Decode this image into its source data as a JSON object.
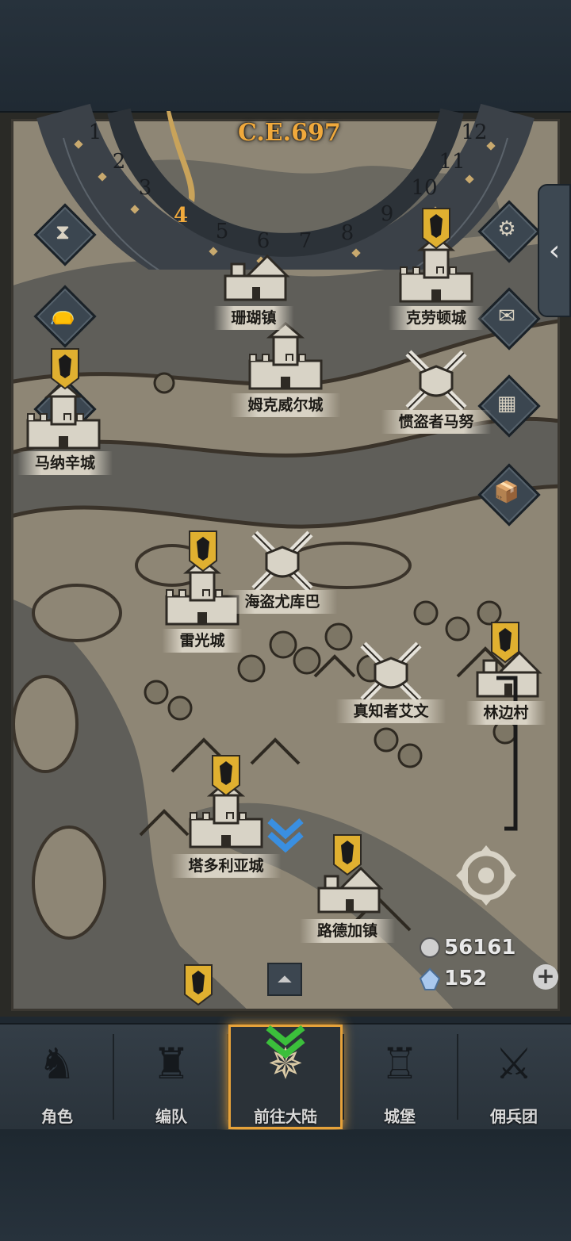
{
  "calendar": {
    "year": "C.E.697",
    "months": [
      "1",
      "2",
      "3",
      "4",
      "5",
      "6",
      "7",
      "8",
      "9",
      "10",
      "11",
      "12"
    ],
    "current_month": "4"
  },
  "locations": [
    {
      "key": "shanhu",
      "label": "珊瑚镇",
      "type": "town"
    },
    {
      "key": "kelaodun",
      "label": "克劳顿城",
      "type": "castle"
    },
    {
      "key": "mukeweier",
      "label": "姆克威尔城",
      "type": "castle"
    },
    {
      "key": "manu",
      "label": "惯盗者马努",
      "type": "battle"
    },
    {
      "key": "manaxin",
      "label": "马纳辛城",
      "type": "castle"
    },
    {
      "key": "youkuba",
      "label": "海盗尤库巴",
      "type": "battle"
    },
    {
      "key": "leiguang",
      "label": "雷光城",
      "type": "castle"
    },
    {
      "key": "aiwen",
      "label": "真知者艾文",
      "type": "battle"
    },
    {
      "key": "linbian",
      "label": "林边村",
      "type": "village"
    },
    {
      "key": "taduoliya",
      "label": "塔多利亚城",
      "type": "castle"
    },
    {
      "key": "ludejia",
      "label": "路德加镇",
      "type": "town"
    }
  ],
  "side_buttons": [
    "hourglass-icon",
    "bag-icon",
    "scroll-icon",
    "gear-icon",
    "mail-icon",
    "board-icon",
    "supplies-icon"
  ],
  "currency": {
    "silver": "56161",
    "crystal": "152"
  },
  "nav": [
    {
      "label": "角色",
      "icon": "knight-icon"
    },
    {
      "label": "编队",
      "icon": "team-icon"
    },
    {
      "label": "前往大陆",
      "icon": "continent-icon",
      "active": true
    },
    {
      "label": "城堡",
      "icon": "castle-icon"
    },
    {
      "label": "佣兵团",
      "icon": "mercenary-icon"
    }
  ],
  "colors": {
    "accent": "#f0a93c",
    "banner_gold": "#e0b030",
    "map_land": "#8e8675",
    "map_water": "#5f5e59"
  }
}
